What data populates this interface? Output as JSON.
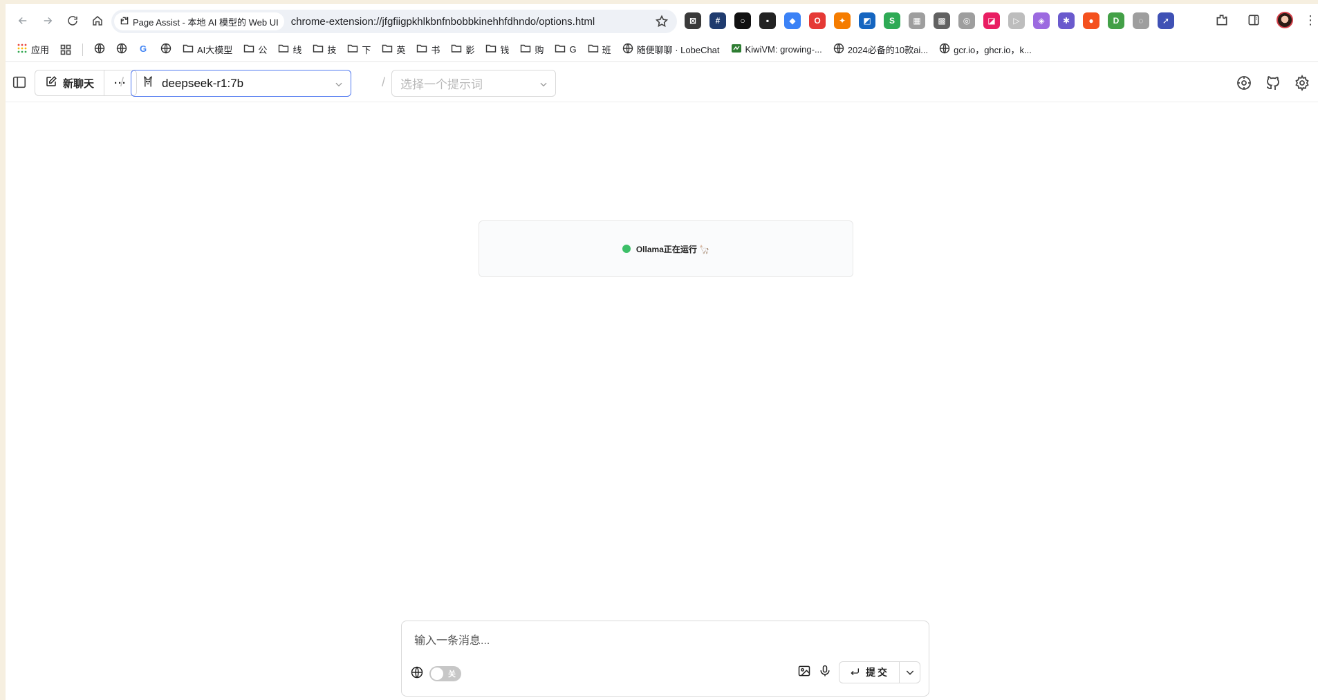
{
  "browser": {
    "tab_title": "Page Assist - 本地 AI 模型的 Web UI",
    "url": "chrome-extension://jfgfiigpkhlkbnfnbobbkinehhfdhndo/options.html",
    "extension_icons": [
      {
        "name": "ext-icon-1",
        "color": "#3a3a3a",
        "glyph": "⊠"
      },
      {
        "name": "ext-icon-2",
        "color": "#1f3b6e",
        "glyph": "#"
      },
      {
        "name": "ext-icon-3",
        "color": "#111111",
        "glyph": "○"
      },
      {
        "name": "ext-icon-4",
        "color": "#222222",
        "glyph": "▪"
      },
      {
        "name": "ext-icon-5",
        "color": "#3b82f6",
        "glyph": "◆"
      },
      {
        "name": "ext-icon-6",
        "color": "#e53935",
        "glyph": "O"
      },
      {
        "name": "ext-icon-7",
        "color": "#f57c00",
        "glyph": "✦"
      },
      {
        "name": "ext-icon-8",
        "color": "#1565c0",
        "glyph": "◩"
      },
      {
        "name": "ext-icon-9",
        "color": "#2eaa55",
        "glyph": "S"
      },
      {
        "name": "ext-icon-10",
        "color": "#9e9e9e",
        "glyph": "▦"
      },
      {
        "name": "ext-icon-11",
        "color": "#616161",
        "glyph": "▩"
      },
      {
        "name": "ext-icon-12",
        "color": "#9e9e9e",
        "glyph": "◎"
      },
      {
        "name": "ext-icon-13",
        "color": "#e91e63",
        "glyph": "◪"
      },
      {
        "name": "ext-icon-14",
        "color": "#bdbdbd",
        "glyph": "▷"
      },
      {
        "name": "ext-icon-15",
        "color": "#9c6ae0",
        "glyph": "◈"
      },
      {
        "name": "ext-icon-16",
        "color": "#6a5acd",
        "glyph": "✱"
      },
      {
        "name": "ext-icon-17",
        "color": "#f4511e",
        "glyph": "●"
      },
      {
        "name": "ext-icon-18",
        "color": "#43a047",
        "glyph": "D"
      },
      {
        "name": "ext-icon-19",
        "color": "#9e9e9e",
        "glyph": "◌"
      },
      {
        "name": "ext-icon-20",
        "color": "#3f51b5",
        "glyph": "➚"
      }
    ]
  },
  "bookmarks": {
    "apps": "应用",
    "items": [
      {
        "label": "",
        "icon": "globe-icon"
      },
      {
        "label": "",
        "icon": "globe-icon"
      },
      {
        "label": "",
        "icon": "google-icon"
      },
      {
        "label": "",
        "icon": "globe-icon"
      },
      {
        "label": "AI大模型",
        "icon": "folder-icon"
      },
      {
        "label": "公",
        "icon": "folder-icon"
      },
      {
        "label": "线",
        "icon": "folder-icon"
      },
      {
        "label": "技",
        "icon": "folder-icon"
      },
      {
        "label": "下",
        "icon": "folder-icon"
      },
      {
        "label": "英",
        "icon": "folder-icon"
      },
      {
        "label": "书",
        "icon": "folder-icon"
      },
      {
        "label": "影",
        "icon": "folder-icon"
      },
      {
        "label": "钱",
        "icon": "folder-icon"
      },
      {
        "label": "购",
        "icon": "folder-icon"
      },
      {
        "label": "G",
        "icon": "folder-icon"
      },
      {
        "label": "班",
        "icon": "folder-icon"
      },
      {
        "label": "随便聊聊 · LobeChat",
        "icon": "globe-icon"
      },
      {
        "label": "KiwiVM: growing-...",
        "icon": "kiwi-icon"
      },
      {
        "label": "2024必备的10款ai...",
        "icon": "globe-icon"
      },
      {
        "label": "gcr.io，ghcr.io，k...",
        "icon": "globe-icon"
      }
    ]
  },
  "header": {
    "new_chat": "新聊天",
    "more": "···",
    "model": "deepseek-r1:7b",
    "prompt_placeholder": "选择一个提示词"
  },
  "status": {
    "text": "Ollama正在运行 🦙"
  },
  "composer": {
    "placeholder": "输入一条消息...",
    "web_toggle_label": "关",
    "submit_label": "提交"
  }
}
